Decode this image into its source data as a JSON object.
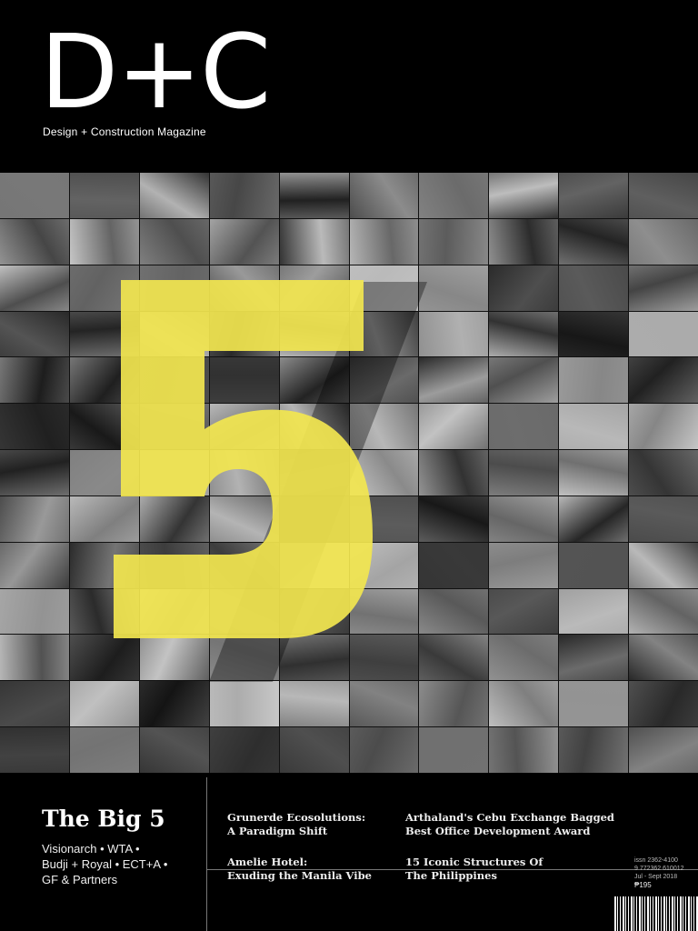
{
  "masthead": {
    "logo": "D+C",
    "tagline": "Design + Construction Magazine"
  },
  "cover_numeral": "5",
  "colors": {
    "accent_yellow": "#f2e64f",
    "background": "#000000"
  },
  "feature": {
    "title": "The Big 5",
    "names": [
      "Visionarch  •  WTA  •",
      "Budji + Royal  •  ECT+A  •",
      "GF & Partners"
    ]
  },
  "stories": [
    {
      "line1": "Grunerde Ecosolutions:",
      "line2": "A Paradigm Shift"
    },
    {
      "line1": "Arthaland's Cebu Exchange Bagged",
      "line2": "Best Office Development Award"
    },
    {
      "line1": "Amelie Hotel:",
      "line2": "Exuding the Manila Vibe"
    },
    {
      "line1": "15 Iconic Structures Of",
      "line2": "The Philippines"
    }
  ],
  "issue_info": {
    "issn": "issn 2362-4100",
    "code": "9 772362 610012",
    "date": "Jul - Sept 2018",
    "price": "₱195"
  }
}
